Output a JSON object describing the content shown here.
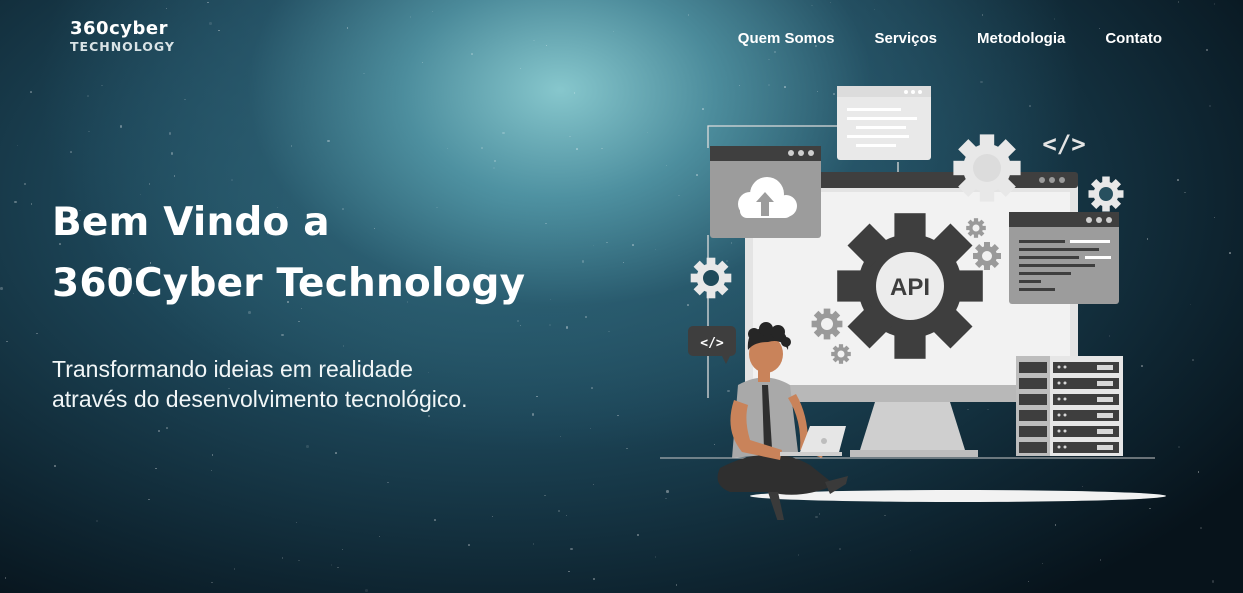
{
  "brand": {
    "line1": "360cyber",
    "line2": "TECHNOLOGY"
  },
  "nav": {
    "items": [
      {
        "label": "Quem Somos"
      },
      {
        "label": "Serviços"
      },
      {
        "label": "Metodologia"
      },
      {
        "label": "Contato"
      }
    ]
  },
  "hero": {
    "title_line1": "Bem Vindo a",
    "title_line2": "360Cyber Technology",
    "subtitle_line1": "Transformando ideias em realidade",
    "subtitle_line2": "através do desenvolvimento tecnológico."
  },
  "illustration": {
    "api_label": "API",
    "code_tag": "</>",
    "colors": {
      "dark": "#3e3e3e",
      "light": "#e6e6e6",
      "mid": "#9a9a9a",
      "skin": "#c9835a"
    }
  }
}
